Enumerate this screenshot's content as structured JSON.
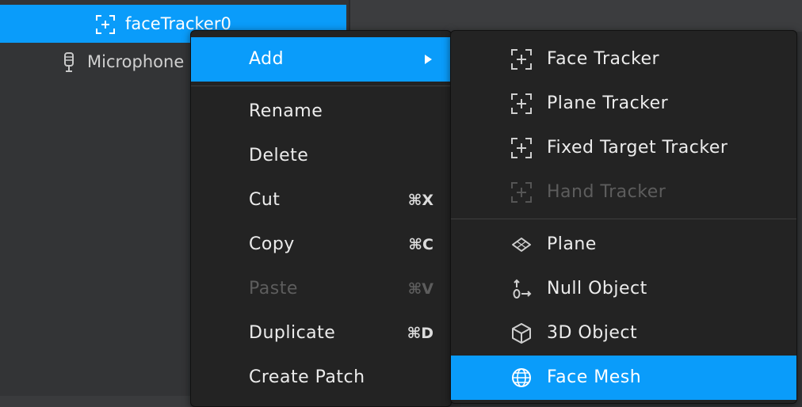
{
  "scene_tree": {
    "selected_item": "faceTracker0",
    "items": [
      "faceTracker0",
      "Microphone"
    ]
  },
  "context_menu": {
    "items": [
      {
        "label": "Add",
        "has_submenu": true,
        "highlighted": true
      },
      {
        "label": "Rename"
      },
      {
        "label": "Delete"
      },
      {
        "label": "Cut",
        "shortcut": "⌘X"
      },
      {
        "label": "Copy",
        "shortcut": "⌘C"
      },
      {
        "label": "Paste",
        "shortcut": "⌘V",
        "disabled": true
      },
      {
        "label": "Duplicate",
        "shortcut": "⌘D"
      },
      {
        "label": "Create Patch"
      }
    ]
  },
  "add_submenu": {
    "items": [
      {
        "label": "Face Tracker",
        "icon": "tracker-icon"
      },
      {
        "label": "Plane Tracker",
        "icon": "tracker-icon"
      },
      {
        "label": "Fixed Target Tracker",
        "icon": "tracker-icon"
      },
      {
        "label": "Hand Tracker",
        "icon": "tracker-icon",
        "disabled": true
      },
      {
        "label": "Plane",
        "icon": "plane-icon"
      },
      {
        "label": "Null Object",
        "icon": "null-object-icon"
      },
      {
        "label": "3D Object",
        "icon": "cube-icon"
      },
      {
        "label": "Face Mesh",
        "icon": "globe-icon",
        "highlighted": true
      }
    ]
  },
  "colors": {
    "highlight": "#0a9cfa",
    "menu_bg": "#232323",
    "panel_bg": "#333436",
    "disabled_text": "#5d5d5d"
  }
}
